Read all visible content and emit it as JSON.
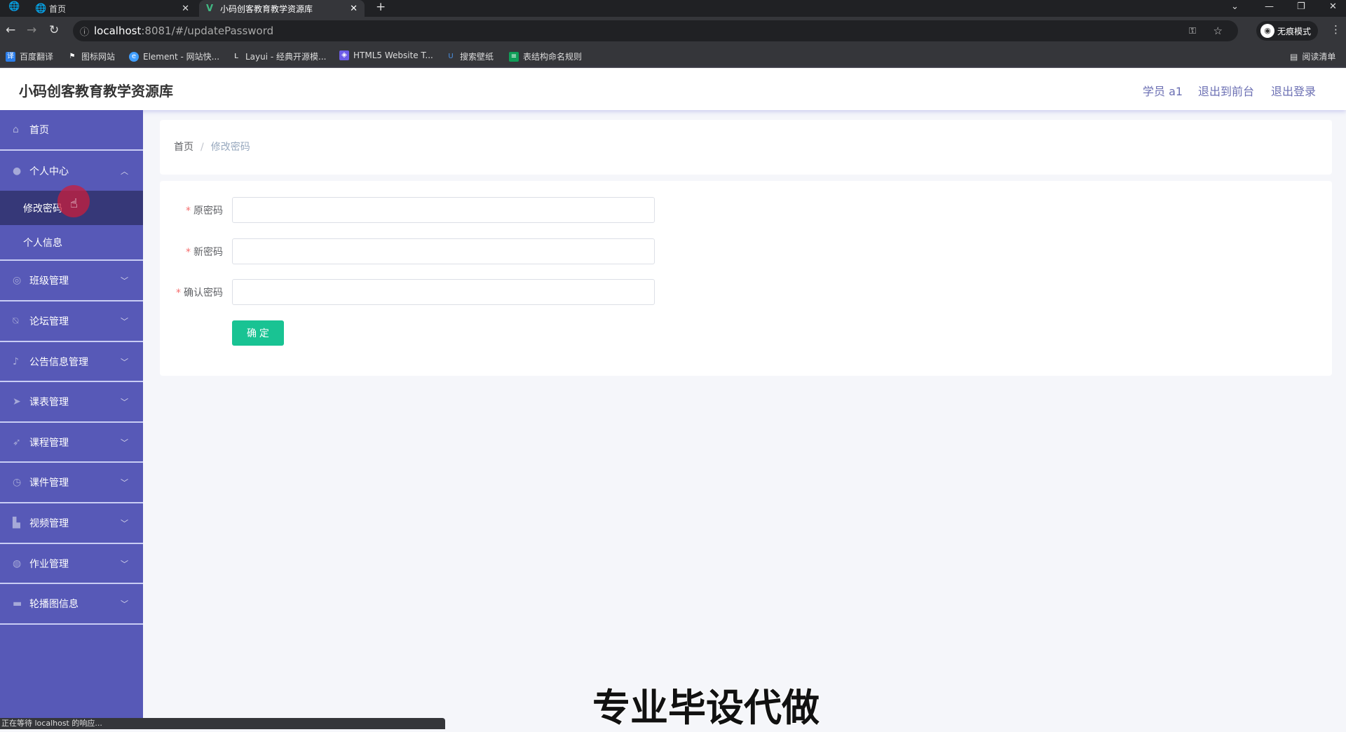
{
  "browser": {
    "tabs": [
      {
        "label": "首页",
        "active": false
      },
      {
        "label": "小码创客教育教学资源库",
        "active": true
      }
    ],
    "url_host": "localhost",
    "url_rest": ":8081/#/updatePassword",
    "incognito_label": "无痕模式",
    "reading_list": "阅读清单",
    "bookmarks": [
      "百度翻译",
      "图标网站",
      "Element - 网站快...",
      "Layui - 经典开源模...",
      "HTML5 Website T...",
      "搜索壁纸",
      "表结构命名规则"
    ],
    "status_text": "正在等待 localhost 的响应..."
  },
  "header": {
    "title": "小码创客教育教学资源库",
    "user": "学员 a1",
    "to_front": "退出到前台",
    "logout": "退出登录"
  },
  "sidebar": {
    "home": "首页",
    "personal": "个人中心",
    "sub": [
      "修改密码",
      "个人信息"
    ],
    "items": [
      "班级管理",
      "论坛管理",
      "公告信息管理",
      "课表管理",
      "课程管理",
      "课件管理",
      "视频管理",
      "作业管理",
      "轮播图信息"
    ]
  },
  "breadcrumb": {
    "home": "首页",
    "sep": "/",
    "current": "修改密码"
  },
  "form": {
    "fields": [
      {
        "label": "原密码",
        "value": ""
      },
      {
        "label": "新密码",
        "value": ""
      },
      {
        "label": "确认密码",
        "value": ""
      }
    ],
    "required_mark": "*",
    "submit": "确 定"
  },
  "watermark": "专业毕设代做",
  "colors": {
    "sidebar": "#5759b7",
    "sidebar_active": "#363878",
    "primary_button": "#19c393",
    "header_link": "#6b6fb3"
  }
}
